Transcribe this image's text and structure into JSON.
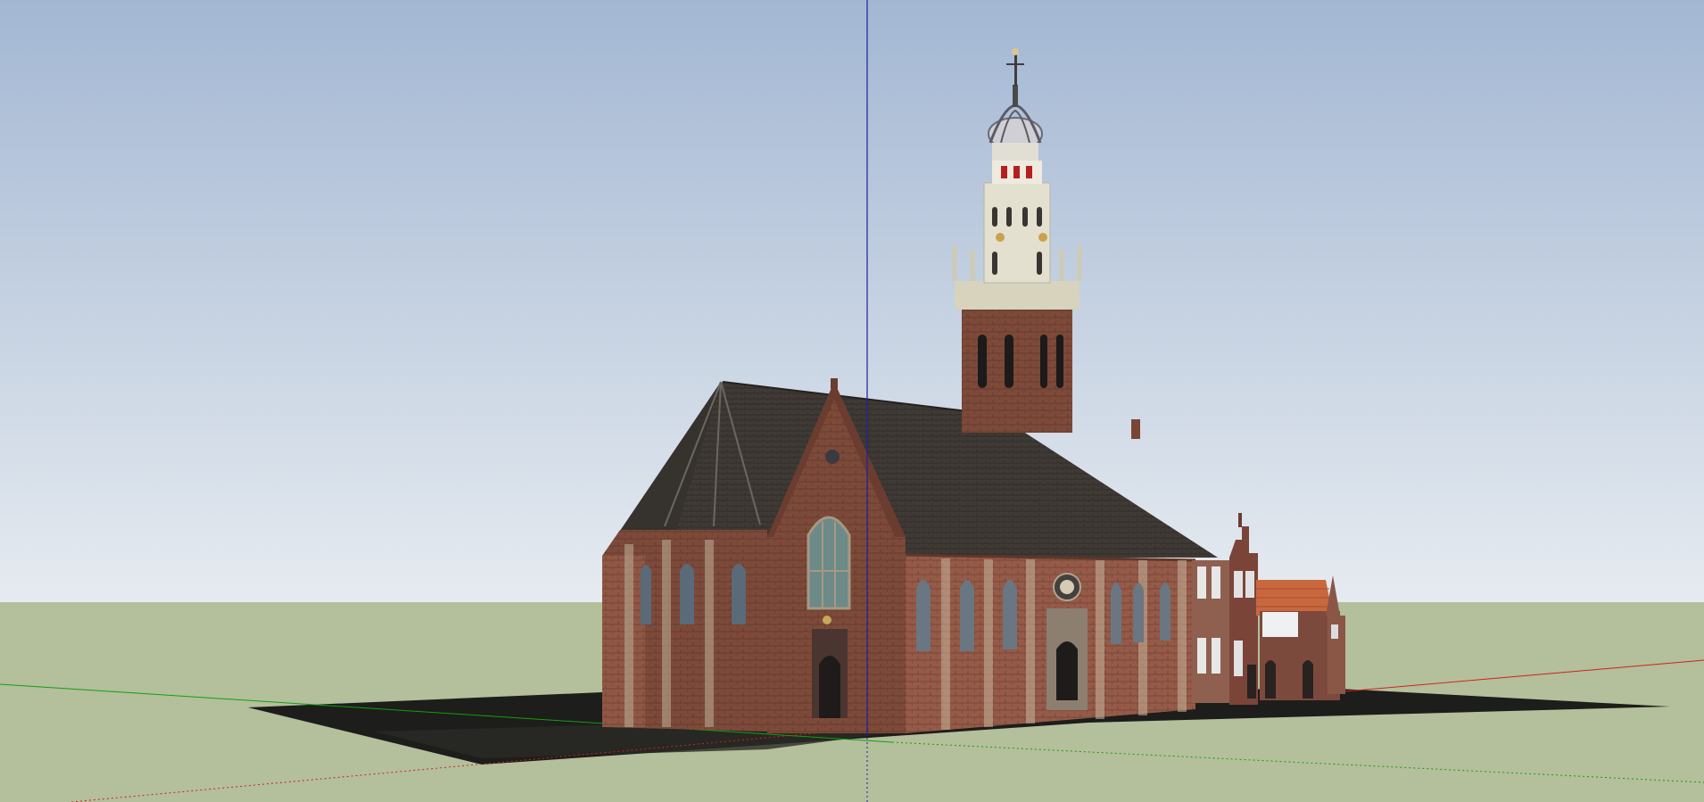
{
  "viewport": {
    "sky_top_color": "#a3b7d3",
    "sky_bottom_color": "#e6ebf0",
    "ground_color": "#b4bf9c",
    "axis_colors": {
      "blue_axis": "#1f1f9e",
      "green_axis": "#10a010",
      "red_axis": "#d02020"
    }
  },
  "model": {
    "brick_color": "#7d4a3a",
    "roof_color": "#3f3a35",
    "tower_top_color": "#dcd8c6",
    "window_color": "#5a6a78"
  }
}
